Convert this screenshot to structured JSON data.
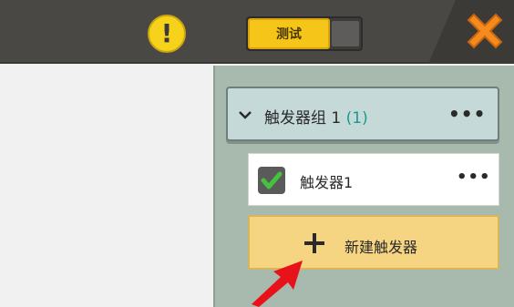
{
  "topbar": {
    "warning_icon": "warning-icon",
    "test_label": "测试",
    "close_icon": "close-icon"
  },
  "panel": {
    "group": {
      "title": "触发器组 1",
      "count": "(1)",
      "more": "•••"
    },
    "triggers": [
      {
        "label": "触发器1",
        "checked": true,
        "more": "•••"
      }
    ],
    "new_trigger_label": "新建触发器"
  },
  "colors": {
    "accent_yellow": "#f6c51a",
    "close_orange": "#f58a1f",
    "panel_bg": "#a8b9ad",
    "header_bg": "#c6d9d9",
    "new_btn_bg": "#f5d581",
    "arrow_red": "#e8121a"
  }
}
